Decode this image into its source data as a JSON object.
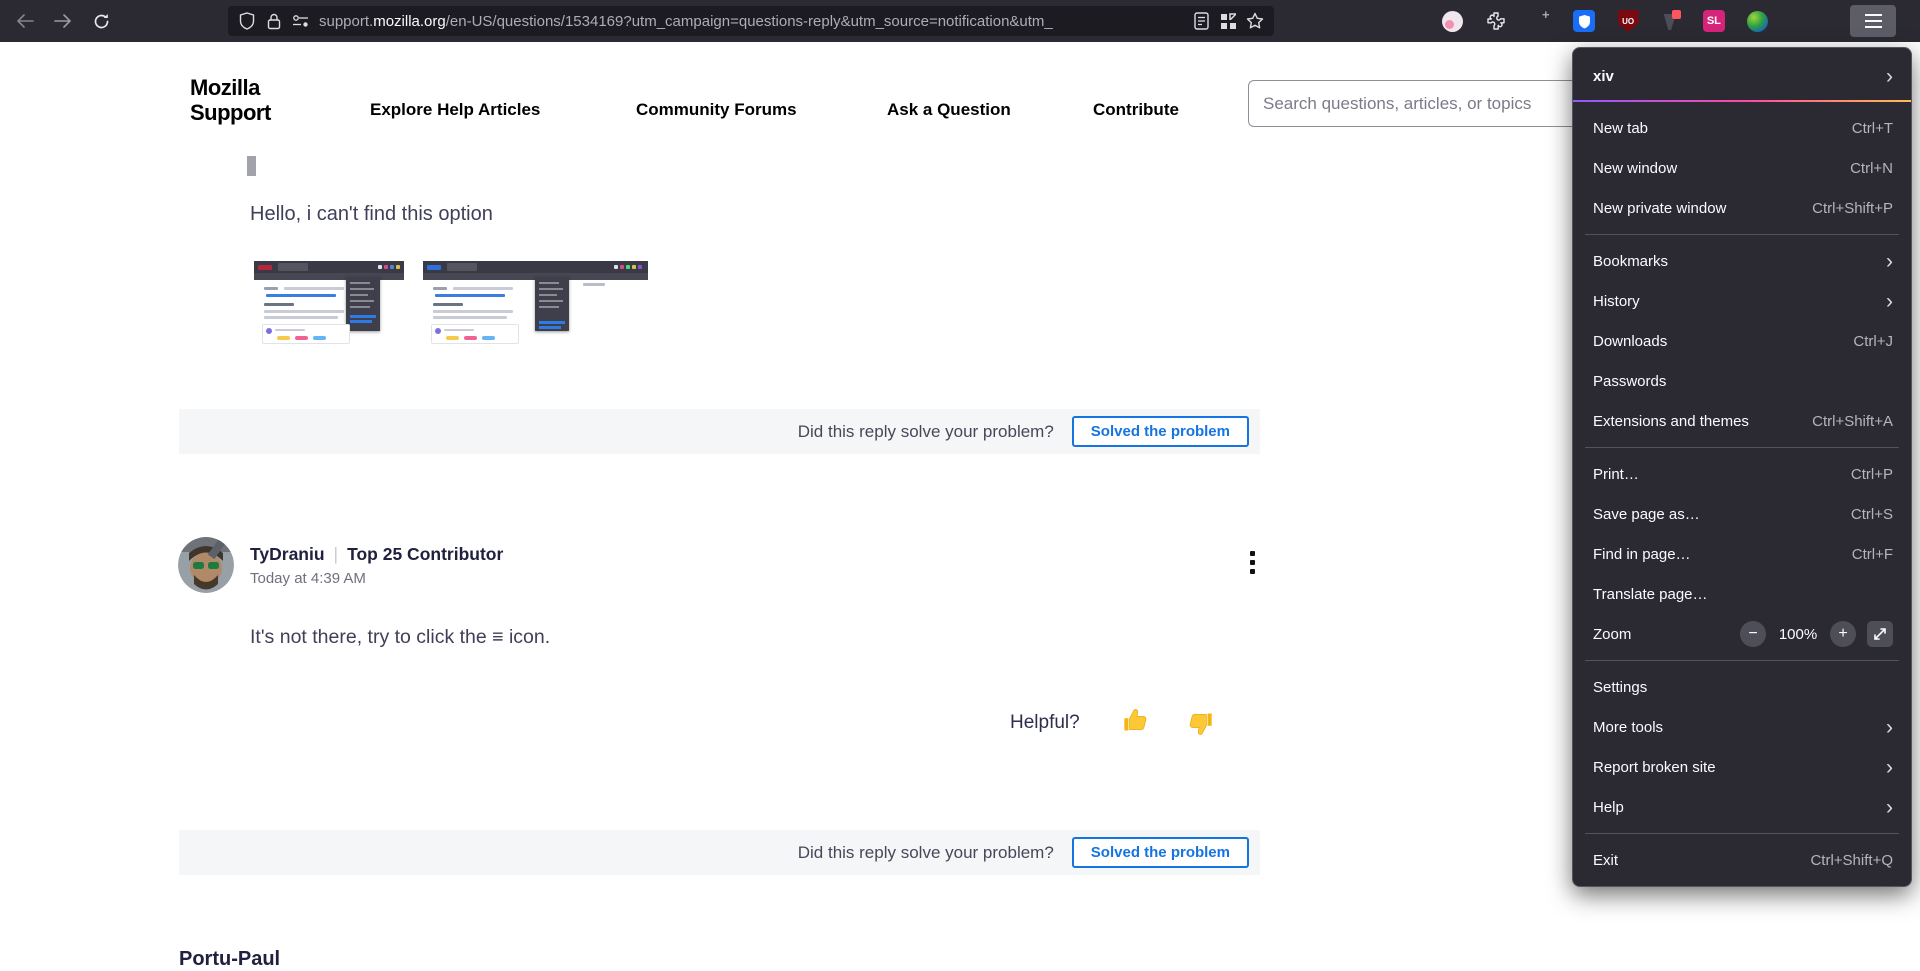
{
  "browser": {
    "url": {
      "prefix": "support.",
      "domain": "mozilla.org",
      "path": "/en-US/questions/1534169?utm_campaign=questions-reply&utm_source=notification&utm_"
    },
    "extensions": {
      "ublock_badge": "UO",
      "simplelogin_badge": "SL"
    }
  },
  "menu": {
    "account_label": "xiv",
    "new_tab": {
      "label": "New tab",
      "shortcut": "Ctrl+T"
    },
    "new_window": {
      "label": "New window",
      "shortcut": "Ctrl+N"
    },
    "new_private_window": {
      "label": "New private window",
      "shortcut": "Ctrl+Shift+P"
    },
    "bookmarks": {
      "label": "Bookmarks"
    },
    "history": {
      "label": "History"
    },
    "downloads": {
      "label": "Downloads",
      "shortcut": "Ctrl+J"
    },
    "passwords": {
      "label": "Passwords"
    },
    "extensions_themes": {
      "label": "Extensions and themes",
      "shortcut": "Ctrl+Shift+A"
    },
    "print": {
      "label": "Print…",
      "shortcut": "Ctrl+P"
    },
    "save_page_as": {
      "label": "Save page as…",
      "shortcut": "Ctrl+S"
    },
    "find_in_page": {
      "label": "Find in page…",
      "shortcut": "Ctrl+F"
    },
    "translate_page": {
      "label": "Translate page…"
    },
    "zoom": {
      "label": "Zoom",
      "value": "100%",
      "minus": "−",
      "plus": "+"
    },
    "settings": {
      "label": "Settings"
    },
    "more_tools": {
      "label": "More tools"
    },
    "report_broken_site": {
      "label": "Report broken site"
    },
    "help": {
      "label": "Help"
    },
    "exit": {
      "label": "Exit",
      "shortcut": "Ctrl+Shift+Q"
    }
  },
  "site_header": {
    "logo_line1": "Mozilla",
    "logo_line2": "Support",
    "nav": [
      "Explore Help Articles",
      "Community Forums",
      "Ask a Question",
      "Contribute"
    ],
    "search_placeholder": "Search questions, articles, or topics"
  },
  "thread": {
    "message1": "Hello, i can't find this option",
    "solve_question": "Did this reply solve your problem?",
    "solve_button": "Solved the problem",
    "reply": {
      "author": "TyDraniu",
      "separator": "|",
      "badge": "Top 25 Contributor",
      "timestamp": "Today at 4:39 AM",
      "body": "It's not there, try to click the ≡ icon.",
      "helpful_label": "Helpful?"
    },
    "next_author": "Portu-Paul"
  }
}
